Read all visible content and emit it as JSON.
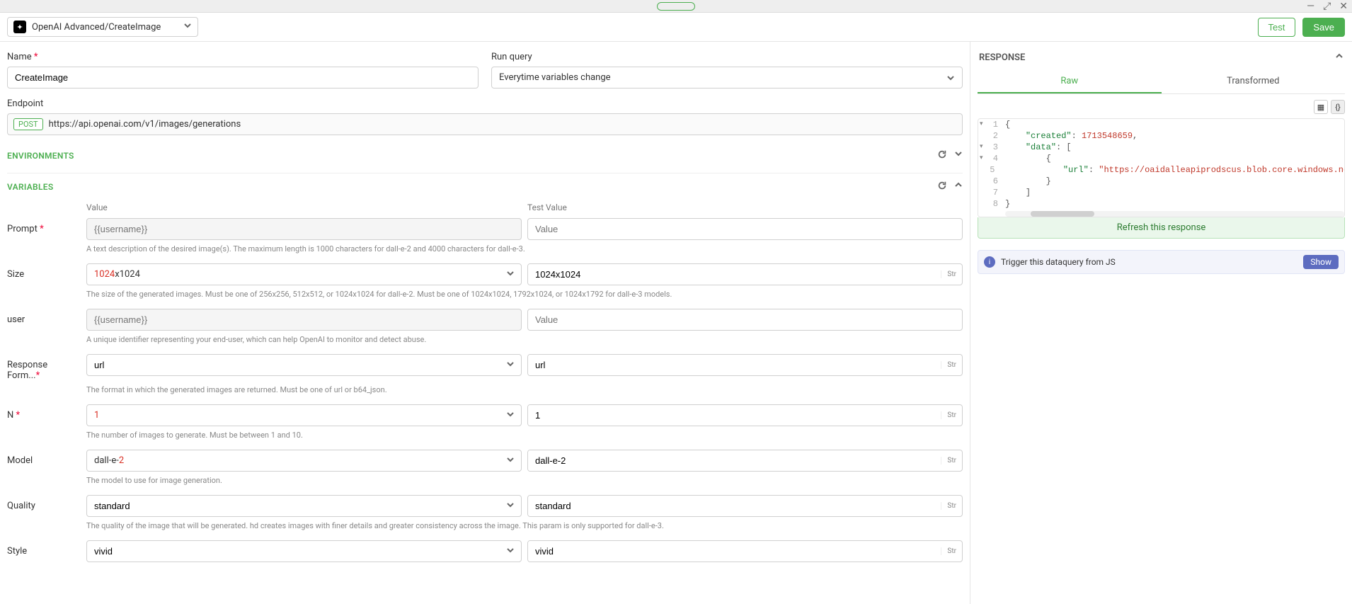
{
  "window": {
    "minimize": "—",
    "maximize": "⤢",
    "close": "✕"
  },
  "header": {
    "breadcrumb": "OpenAI Advanced/CreateImage",
    "test_label": "Test",
    "save_label": "Save"
  },
  "name_field": {
    "label": "Name",
    "value": "CreateImage"
  },
  "run_query": {
    "label": "Run query",
    "value": "Everytime variables change"
  },
  "endpoint": {
    "label": "Endpoint",
    "method": "POST",
    "url": "https://api.openai.com/v1/images/generations"
  },
  "sections": {
    "environments": "ENVIRONMENTS",
    "variables": "VARIABLES"
  },
  "columns": {
    "value": "Value",
    "test_value": "Test Value"
  },
  "type_tag": "Str",
  "vars": {
    "prompt": {
      "label": "Prompt",
      "value_placeholder": "{{username}}",
      "test_placeholder": "Value",
      "help": "A text description of the desired image(s). The maximum length is 1000 characters for dall-e-2 and 4000 characters for dall-e-3."
    },
    "size": {
      "label": "Size",
      "value_prefix": "1024",
      "value_suffix": "x1024",
      "test": "1024x1024",
      "help": "The size of the generated images. Must be one of 256x256, 512x512, or 1024x1024 for dall-e-2. Must be one of 1024x1024, 1792x1024, or 1024x1792 for dall-e-3 models."
    },
    "user": {
      "label": "user",
      "value_placeholder": "{{username}}",
      "test_placeholder": "Value",
      "help": "A unique identifier representing your end-user, which can help OpenAI to monitor and detect abuse."
    },
    "response_format": {
      "label": "Response Form...",
      "value": "url",
      "test": "url",
      "help": "The format in which the generated images are returned. Must be one of url or b64_json."
    },
    "n": {
      "label": "N",
      "value": "1",
      "test": "1",
      "help": "The number of images to generate. Must be between 1 and 10."
    },
    "model": {
      "label": "Model",
      "value_prefix": "dall-e-",
      "value_suffix": "2",
      "test": "dall-e-2",
      "help": "The model to use for image generation."
    },
    "quality": {
      "label": "Quality",
      "value": "standard",
      "test": "standard",
      "help": "The quality of the image that will be generated. hd creates images with finer details and greater consistency across the image. This param is only supported for dall-e-3."
    },
    "style": {
      "label": "Style",
      "value": "vivid",
      "test": "vivid"
    }
  },
  "response": {
    "title": "RESPONSE",
    "tabs": {
      "raw": "Raw",
      "transformed": "Transformed"
    },
    "refresh": "Refresh this response",
    "code_numbers": [
      "1",
      "2",
      "3",
      "4",
      "5",
      "6",
      "7",
      "8"
    ],
    "code": {
      "l2_key": "\"created\"",
      "l2_val": "1713548659",
      "l3_key": "\"data\"",
      "l5_key": "\"url\"",
      "l5_val": "\"https://oaidalleapiprodscus.blob.core.windows.net/private/org-h\\"
    }
  },
  "info_strip": {
    "text": "Trigger this dataquery from JS",
    "show": "Show"
  }
}
